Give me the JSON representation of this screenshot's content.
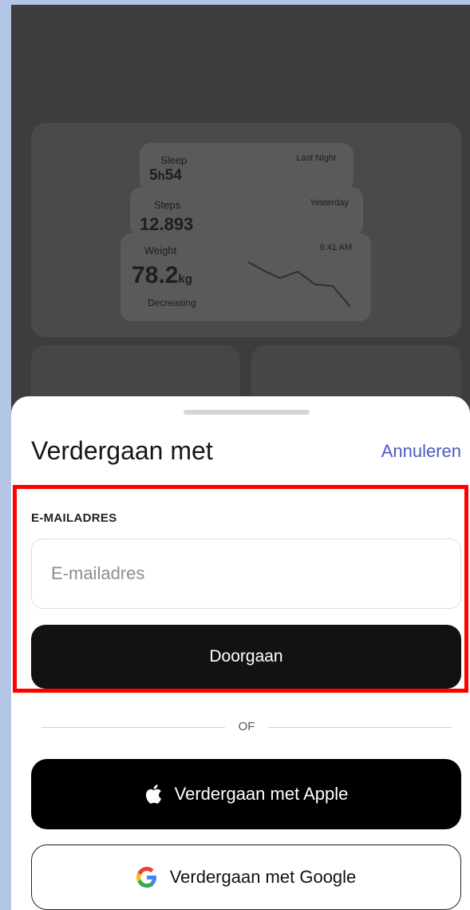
{
  "background": {
    "sleep": {
      "label": "Sleep",
      "time": "Last Night",
      "value": "5",
      "unit_h": "h",
      "value2": "54"
    },
    "steps": {
      "label": "Steps",
      "time": "Yesterday",
      "value": "12.893"
    },
    "weight": {
      "label": "Weight",
      "time": "9:41 AM",
      "value": "78.2",
      "unit": "kg",
      "trend": "Decreasing"
    }
  },
  "sheet": {
    "title": "Verdergaan met",
    "cancel_label": "Annuleren",
    "email_label": "E-MAILADRES",
    "email_placeholder": "E-mailadres",
    "email_value": "",
    "continue_label": "Doorgaan",
    "divider_text": "OF",
    "apple_label": "Verdergaan met Apple",
    "google_label": "Verdergaan met Google"
  },
  "colors": {
    "accent": "#4a5bbf",
    "highlight": "#ff0000",
    "dark_button": "#121212"
  }
}
